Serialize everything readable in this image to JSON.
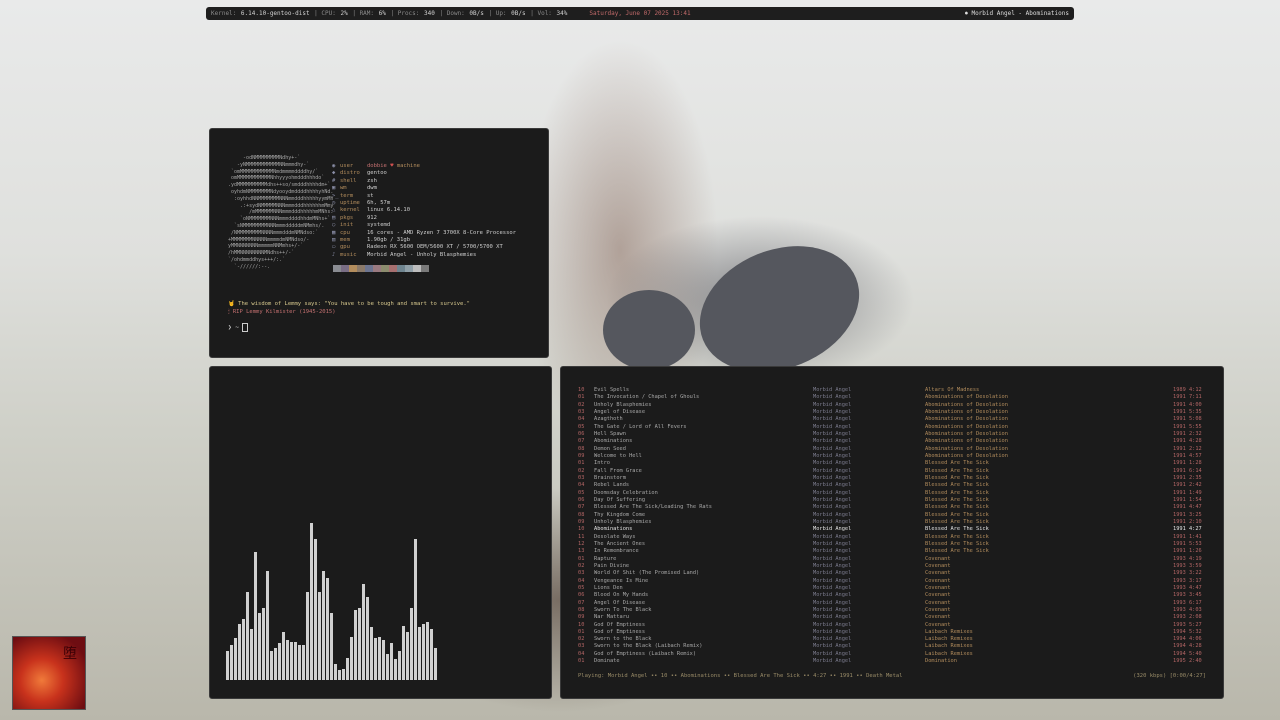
{
  "topbar": {
    "kernel_label": "Kernel:",
    "kernel": "6.14.10-gentoo-dist",
    "cpu_label": "CPU:",
    "cpu": "2%",
    "ram_label": "RAM:",
    "ram": "6%",
    "procs_label": "Procs:",
    "procs": "340",
    "down_label": "Down:",
    "down": "0B/s",
    "up_label": "Up:",
    "up": "0B/s",
    "vol_label": "Vol:",
    "vol": "34%",
    "datetime": "Saturday, June 07 2025 13:41",
    "now_playing": "Morbid Angel - Abominations",
    "colors": {
      "bar_bg": "#1e1e1e",
      "accent": "#c26a6a"
    }
  },
  "fetch": {
    "ascii": "     -odNMMMMMMMMNdhy+-`\n   -yNMMMMMMMMMMMNNmmmdhy-`\n `omMMMMMMMMMMMNmdmmmmddddhy/`\n omMMMMMMMMMMMNhhyyyohmdddhhhdo`\n.ydMMMMMMMMMMdhs++so/smdddhhhhdm+`\n oyhdmNMMMMMMMNdyooydmddddhhhhyhNd.\n  :oyhhdNNMMMMMMMNNNmmdddhhhhhyymMh\n    .:+sydNMMMMMNNNmmmdddhhhhhhmMmy\n       /mMMMMMMNNNmmmdddhhhhhmMNhs:\n    `oNMMMMMMMNNNmmmddddhhdmMNhs+`\n  `sNMMMMMMMMNNNmmmdddddmNMmhs/.\n /NMMMMMMMMNNNNmmmdddmNMNdso:`\n+MMMMMMMNNNNNmmmmdmNMNdso/-\nyMMNNNNNNNmmmmmNNMmhs+/-`\n/hMMNNNNNNNNMNdhs++/-`\n`/ohdmmddhys+++/:.`\n  `-//////:--.",
    "user_name": "dobbie",
    "heart": "♥",
    "host": "machine",
    "rows": [
      {
        "icon": "◉",
        "label": "user",
        "value": ""
      },
      {
        "icon": "◆",
        "label": "distro",
        "value": "gentoo"
      },
      {
        "icon": "#",
        "label": "shell",
        "value": "zsh"
      },
      {
        "icon": "▣",
        "label": "wm",
        "value": "dwm"
      },
      {
        "icon": ">_",
        "label": "term",
        "value": "st"
      },
      {
        "icon": "◷",
        "label": "uptime",
        "value": "6h, 57m"
      },
      {
        "icon": "△",
        "label": "kernel",
        "value": "linux 6.14.10"
      },
      {
        "icon": "▤",
        "label": "pkgs",
        "value": "912"
      },
      {
        "icon": "○",
        "label": "init",
        "value": "systemd"
      },
      {
        "icon": "▦",
        "label": "cpu",
        "value": "16 cores - AMD Ryzen 7 3700X 8-Core Processor"
      },
      {
        "icon": "▥",
        "label": "mem",
        "value": "1.90gb / 31gb"
      },
      {
        "icon": "▭",
        "label": "gpu",
        "value": "Radeon RX 5600 OEM/5600 XT / 5700/5700 XT"
      },
      {
        "icon": "♪",
        "label": "music",
        "value": "Morbid Angel - Unholy Blasphemies"
      }
    ],
    "swatches": [
      "#8a8c92",
      "#7a6e85",
      "#b38d5d",
      "#8b7a6a",
      "#6d7590",
      "#9a7a80",
      "#8c8c6e",
      "#a77070",
      "#6f8590",
      "#90a0a8",
      "#bdbdbd",
      "#7a7a7a"
    ],
    "quote_line": "The wisdom of Lemmy says: \"You have to be tough and smart to survive.\"",
    "rip_line": "RIP Lemmy Kilmister (1945-2015)",
    "prompt": "❯ ~"
  },
  "visualizer": {
    "bar_color": "#d0d0d0",
    "levels": [
      0.18,
      0.22,
      0.26,
      0.35,
      0.38,
      0.55,
      0.32,
      0.8,
      0.42,
      0.45,
      0.68,
      0.18,
      0.2,
      0.23,
      0.3,
      0.25,
      0.24,
      0.24,
      0.22,
      0.22,
      0.55,
      0.98,
      0.88,
      0.55,
      0.68,
      0.64,
      0.42,
      0.1,
      0.06,
      0.07,
      0.14,
      0.27,
      0.44,
      0.45,
      0.6,
      0.52,
      0.33,
      0.26,
      0.27,
      0.25,
      0.16,
      0.23,
      0.13,
      0.18,
      0.34,
      0.3,
      0.45,
      0.88,
      0.33,
      0.35,
      0.36,
      0.32,
      0.2
    ]
  },
  "player": {
    "tracks": [
      {
        "n": "10",
        "title": "Evil Spells",
        "artist": "Morbid Angel",
        "album": "Altars Of Madness",
        "year": "1989",
        "len": "4:12"
      },
      {
        "n": "01",
        "title": "The Invocation / Chapel of Ghouls",
        "artist": "Morbid Angel",
        "album": "Abominations of Desolation",
        "year": "1991",
        "len": "7:11"
      },
      {
        "n": "02",
        "title": "Unholy Blasphemies",
        "artist": "Morbid Angel",
        "album": "Abominations of Desolation",
        "year": "1991",
        "len": "4:00"
      },
      {
        "n": "03",
        "title": "Angel of Disease",
        "artist": "Morbid Angel",
        "album": "Abominations of Desolation",
        "year": "1991",
        "len": "5:35"
      },
      {
        "n": "04",
        "title": "Azagthoth",
        "artist": "Morbid Angel",
        "album": "Abominations of Desolation",
        "year": "1991",
        "len": "5:08"
      },
      {
        "n": "05",
        "title": "The Gate / Lord of All Fevers",
        "artist": "Morbid Angel",
        "album": "Abominations of Desolation",
        "year": "1991",
        "len": "5:55"
      },
      {
        "n": "06",
        "title": "Hell Spawn",
        "artist": "Morbid Angel",
        "album": "Abominations of Desolation",
        "year": "1991",
        "len": "2:32"
      },
      {
        "n": "07",
        "title": "Abominations",
        "artist": "Morbid Angel",
        "album": "Abominations of Desolation",
        "year": "1991",
        "len": "4:28"
      },
      {
        "n": "08",
        "title": "Demon Seed",
        "artist": "Morbid Angel",
        "album": "Abominations of Desolation",
        "year": "1991",
        "len": "2:12"
      },
      {
        "n": "09",
        "title": "Welcome to Hell",
        "artist": "Morbid Angel",
        "album": "Abominations of Desolation",
        "year": "1991",
        "len": "4:57"
      },
      {
        "n": "01",
        "title": "Intro",
        "artist": "Morbid Angel",
        "album": "Blessed Are The Sick",
        "year": "1991",
        "len": "1:28"
      },
      {
        "n": "02",
        "title": "Fall From Grace",
        "artist": "Morbid Angel",
        "album": "Blessed Are The Sick",
        "year": "1991",
        "len": "6:14"
      },
      {
        "n": "03",
        "title": "Brainstorm",
        "artist": "Morbid Angel",
        "album": "Blessed Are The Sick",
        "year": "1991",
        "len": "2:35"
      },
      {
        "n": "04",
        "title": "Rebel Lands",
        "artist": "Morbid Angel",
        "album": "Blessed Are The Sick",
        "year": "1991",
        "len": "2:42"
      },
      {
        "n": "05",
        "title": "Doomsday Celebration",
        "artist": "Morbid Angel",
        "album": "Blessed Are The Sick",
        "year": "1991",
        "len": "1:49"
      },
      {
        "n": "06",
        "title": "Day Of Suffering",
        "artist": "Morbid Angel",
        "album": "Blessed Are The Sick",
        "year": "1991",
        "len": "1:54"
      },
      {
        "n": "07",
        "title": "Blessed Are The Sick/Leading The Rats",
        "artist": "Morbid Angel",
        "album": "Blessed Are The Sick",
        "year": "1991",
        "len": "4:47"
      },
      {
        "n": "08",
        "title": "Thy Kingdom Come",
        "artist": "Morbid Angel",
        "album": "Blessed Are The Sick",
        "year": "1991",
        "len": "3:25"
      },
      {
        "n": "09",
        "title": "Unholy Blasphemies",
        "artist": "Morbid Angel",
        "album": "Blessed Are The Sick",
        "year": "1991",
        "len": "2:10"
      },
      {
        "n": "10",
        "title": "Abominations",
        "artist": "Morbid Angel",
        "album": "Blessed Are The Sick",
        "year": "1991",
        "len": "4:27",
        "current": true
      },
      {
        "n": "11",
        "title": "Desolate Ways",
        "artist": "Morbid Angel",
        "album": "Blessed Are The Sick",
        "year": "1991",
        "len": "1:41"
      },
      {
        "n": "12",
        "title": "The Ancient Ones",
        "artist": "Morbid Angel",
        "album": "Blessed Are The Sick",
        "year": "1991",
        "len": "5:53"
      },
      {
        "n": "13",
        "title": "In Remembrance",
        "artist": "Morbid Angel",
        "album": "Blessed Are The Sick",
        "year": "1991",
        "len": "1:26"
      },
      {
        "n": "01",
        "title": "Rapture",
        "artist": "Morbid Angel",
        "album": "Covenant",
        "year": "1993",
        "len": "4:19"
      },
      {
        "n": "02",
        "title": "Pain Divine",
        "artist": "Morbid Angel",
        "album": "Covenant",
        "year": "1993",
        "len": "3:59"
      },
      {
        "n": "03",
        "title": "World Of Shit (The Promised Land)",
        "artist": "Morbid Angel",
        "album": "Covenant",
        "year": "1993",
        "len": "3:22"
      },
      {
        "n": "04",
        "title": "Vengeance Is Mine",
        "artist": "Morbid Angel",
        "album": "Covenant",
        "year": "1993",
        "len": "3:17"
      },
      {
        "n": "05",
        "title": "Lions Den",
        "artist": "Morbid Angel",
        "album": "Covenant",
        "year": "1993",
        "len": "4:47"
      },
      {
        "n": "06",
        "title": "Blood On My Hands",
        "artist": "Morbid Angel",
        "album": "Covenant",
        "year": "1993",
        "len": "3:45"
      },
      {
        "n": "07",
        "title": "Angel Of Disease",
        "artist": "Morbid Angel",
        "album": "Covenant",
        "year": "1993",
        "len": "6:17"
      },
      {
        "n": "08",
        "title": "Sworn To The Black",
        "artist": "Morbid Angel",
        "album": "Covenant",
        "year": "1993",
        "len": "4:03"
      },
      {
        "n": "09",
        "title": "Nar Mattaru",
        "artist": "Morbid Angel",
        "album": "Covenant",
        "year": "1993",
        "len": "2:08"
      },
      {
        "n": "10",
        "title": "God Of Emptiness",
        "artist": "Morbid Angel",
        "album": "Covenant",
        "year": "1993",
        "len": "5:27"
      },
      {
        "n": "01",
        "title": "God of Emptiness",
        "artist": "Morbid Angel",
        "album": "Laibach Remixes",
        "year": "1994",
        "len": "5:32"
      },
      {
        "n": "02",
        "title": "Sworn to the Black",
        "artist": "Morbid Angel",
        "album": "Laibach Remixes",
        "year": "1994",
        "len": "4:06"
      },
      {
        "n": "03",
        "title": "Sworn to the Black (Laibach Remix)",
        "artist": "Morbid Angel",
        "album": "Laibach Remixes",
        "year": "1994",
        "len": "4:28"
      },
      {
        "n": "04",
        "title": "God of Emptiness (Laibach Remix)",
        "artist": "Morbid Angel",
        "album": "Laibach Remixes",
        "year": "1994",
        "len": "5:40"
      },
      {
        "n": "01",
        "title": "Dominate",
        "artist": "Morbid Angel",
        "album": "Domination",
        "year": "1995",
        "len": "2:40"
      }
    ],
    "status_line": "Playing: Morbid Angel •• 10 •• Abominations •• Blessed Are The Sick •• 4:27 •• 1991 •• Death Metal",
    "status_right": "(320 kbps) [0:00/4:27]"
  },
  "album_art": {
    "glyph": "堕"
  }
}
